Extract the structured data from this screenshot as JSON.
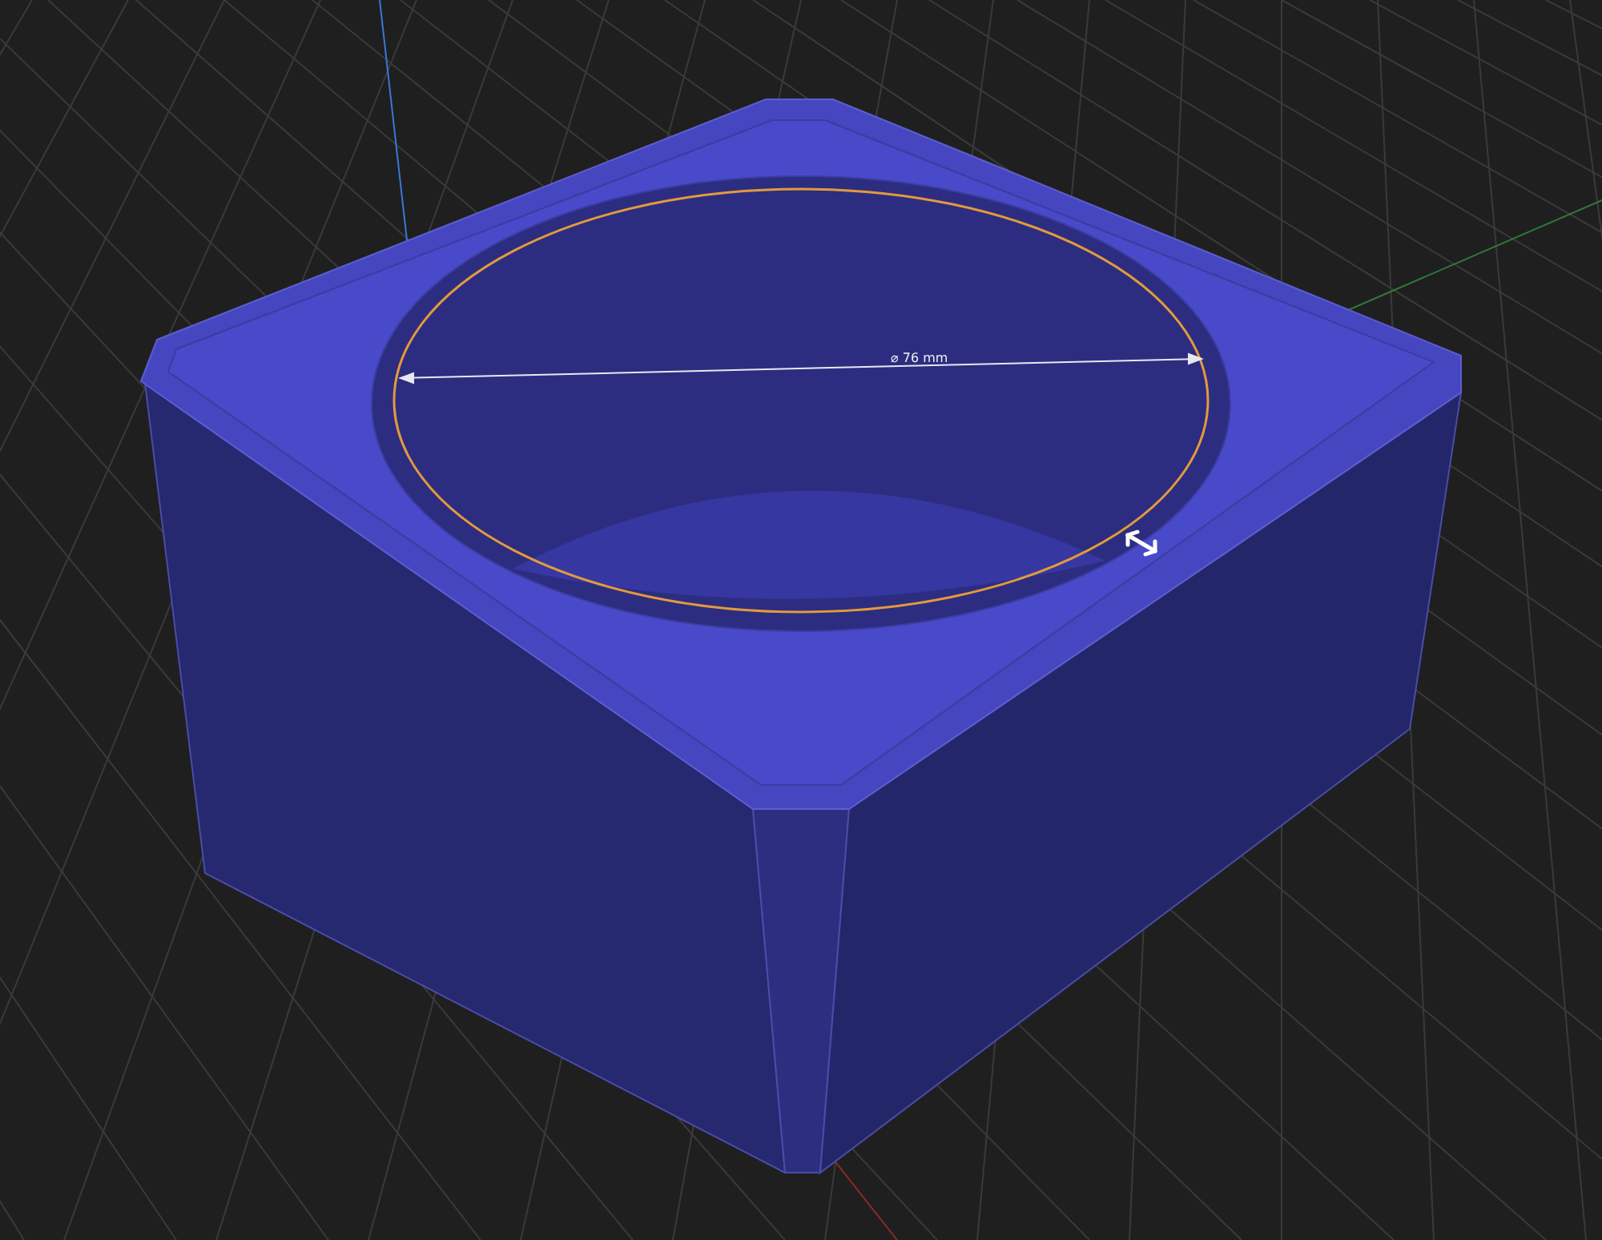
{
  "viewport": {
    "dimension": {
      "label": "⌀ 76 mm"
    }
  }
}
